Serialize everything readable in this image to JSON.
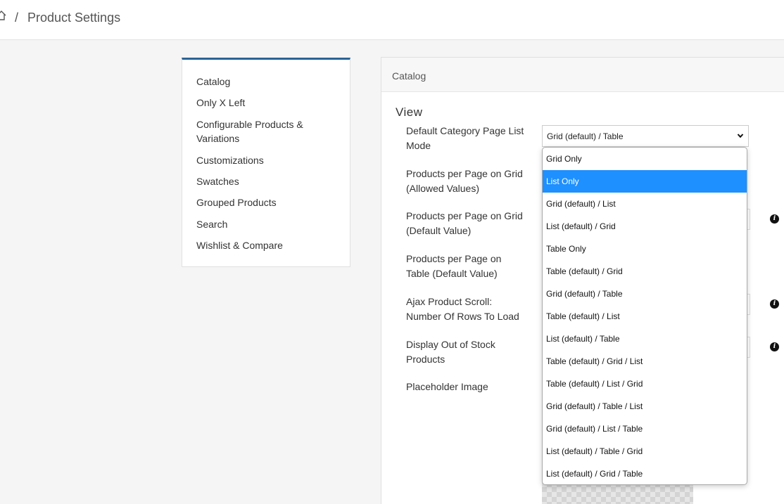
{
  "breadcrumb": {
    "separator": "/",
    "title": "Product Settings"
  },
  "sidebar": {
    "items": [
      {
        "label": "Catalog"
      },
      {
        "label": "Only X Left"
      },
      {
        "label": "Configurable Products & Variations"
      },
      {
        "label": "Customizations"
      },
      {
        "label": "Swatches"
      },
      {
        "label": "Grouped Products"
      },
      {
        "label": "Search"
      },
      {
        "label": "Wishlist & Compare"
      }
    ]
  },
  "panel": {
    "header": "Catalog",
    "section_title": "View",
    "fields": [
      {
        "label": "Default Category Page List Mode"
      },
      {
        "label": "Products per Page on Grid (Allowed Values)"
      },
      {
        "label": "Products per Page on Grid (Default Value)"
      },
      {
        "label": "Products per Page on Table (Default Value)"
      },
      {
        "label": "Ajax Product Scroll: Number Of Rows To Load"
      },
      {
        "label": "Display Out of Stock Products"
      },
      {
        "label": "Placeholder Image"
      }
    ],
    "list_mode_select": {
      "value": "Grid (default) / Table"
    }
  },
  "dropdown": {
    "selected_index": 1,
    "options": [
      "Grid Only",
      "List Only",
      "Grid (default) / List",
      "List (default) / Grid",
      "Table Only",
      "Table (default) / Grid",
      "Grid (default) / Table",
      "Table (default) / List",
      "List (default) / Table",
      "Table (default) / Grid / List",
      "Table (default) / List / Grid",
      "Grid (default) / Table / List",
      "Grid (default) / List / Table",
      "List (default) / Table / Grid",
      "List (default) / Grid / Table"
    ]
  },
  "colors": {
    "accent": "#2a6496",
    "highlight": "#1e90ff"
  },
  "icons": {
    "home": "home-icon",
    "info": "info-icon",
    "chevron": "chevron-down-icon"
  }
}
